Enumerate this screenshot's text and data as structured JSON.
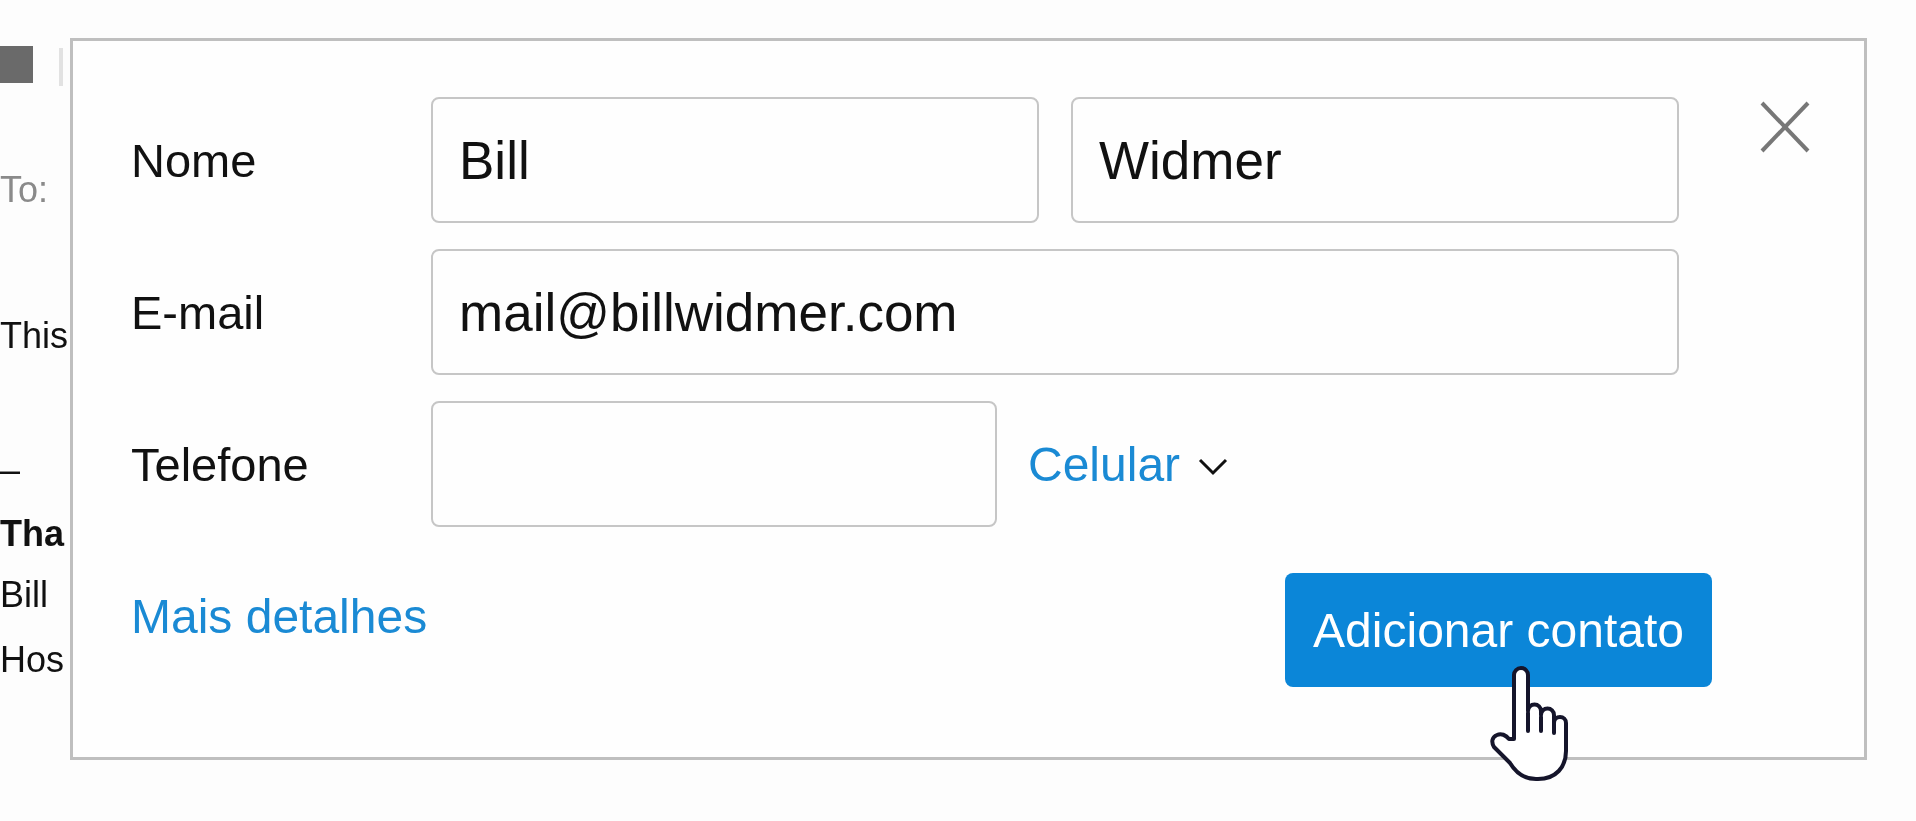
{
  "email_behind": {
    "lines": [
      {
        "text": "To:",
        "kind": "header"
      },
      {
        "text": "This",
        "kind": "body"
      },
      {
        "text": "–",
        "kind": "body"
      },
      {
        "text": "Tha",
        "kind": "bold"
      },
      {
        "text": "Bill",
        "kind": "body"
      },
      {
        "text": "Hos",
        "kind": "body"
      }
    ]
  },
  "dialog": {
    "rows": [
      {
        "kind": "name",
        "label": "Nome",
        "first_name": "Bill",
        "last_name": "Widmer"
      },
      {
        "kind": "email",
        "label": "E-mail",
        "value": "mail@billwidmer.com"
      },
      {
        "kind": "phone",
        "label": "Telefone",
        "type_selector": "Celular"
      }
    ],
    "more_details_link": "Mais detalhes",
    "submit_button": "Adicionar contato"
  }
}
